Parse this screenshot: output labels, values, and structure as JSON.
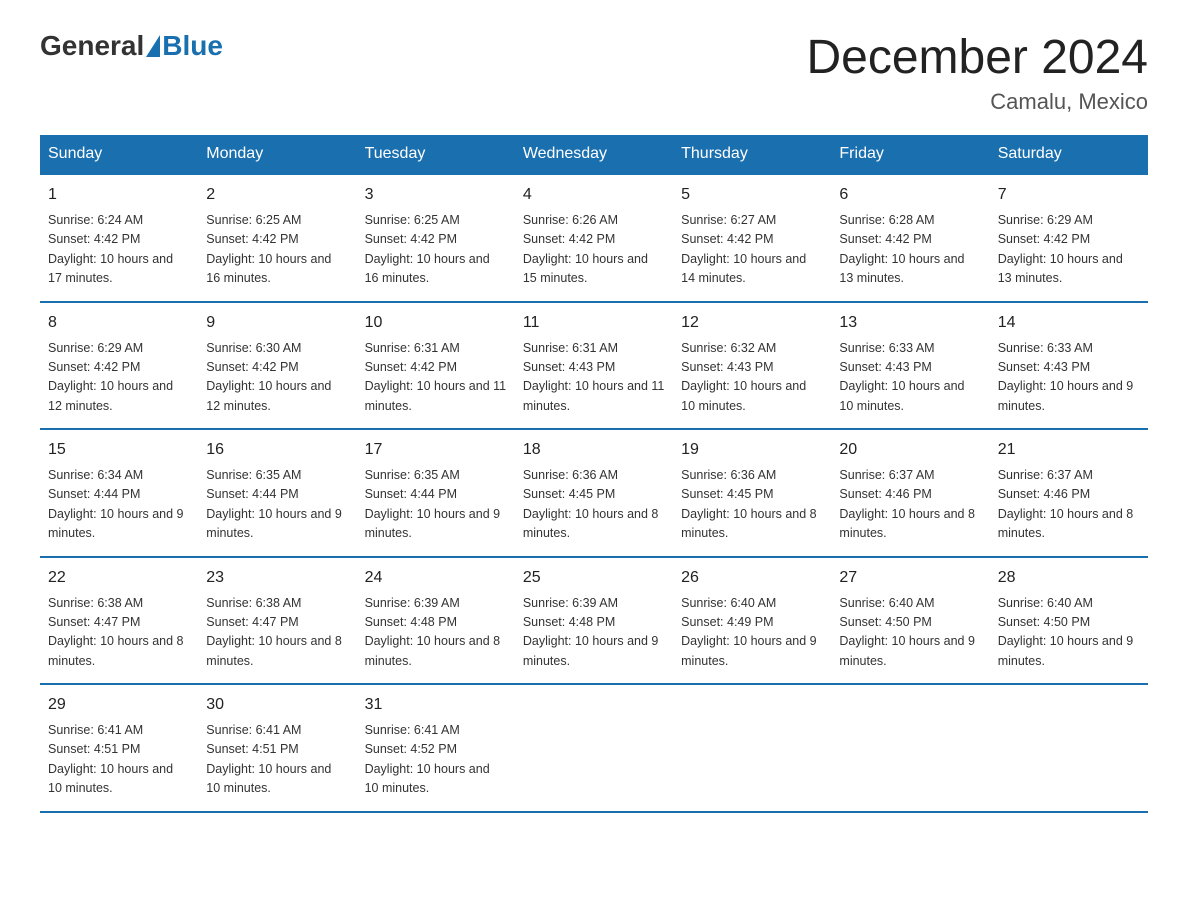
{
  "logo": {
    "general": "General",
    "blue": "Blue"
  },
  "title": {
    "month": "December 2024",
    "location": "Camalu, Mexico"
  },
  "days_of_week": [
    "Sunday",
    "Monday",
    "Tuesday",
    "Wednesday",
    "Thursday",
    "Friday",
    "Saturday"
  ],
  "weeks": [
    [
      {
        "day": "1",
        "sunrise": "6:24 AM",
        "sunset": "4:42 PM",
        "daylight": "10 hours and 17 minutes."
      },
      {
        "day": "2",
        "sunrise": "6:25 AM",
        "sunset": "4:42 PM",
        "daylight": "10 hours and 16 minutes."
      },
      {
        "day": "3",
        "sunrise": "6:25 AM",
        "sunset": "4:42 PM",
        "daylight": "10 hours and 16 minutes."
      },
      {
        "day": "4",
        "sunrise": "6:26 AM",
        "sunset": "4:42 PM",
        "daylight": "10 hours and 15 minutes."
      },
      {
        "day": "5",
        "sunrise": "6:27 AM",
        "sunset": "4:42 PM",
        "daylight": "10 hours and 14 minutes."
      },
      {
        "day": "6",
        "sunrise": "6:28 AM",
        "sunset": "4:42 PM",
        "daylight": "10 hours and 13 minutes."
      },
      {
        "day": "7",
        "sunrise": "6:29 AM",
        "sunset": "4:42 PM",
        "daylight": "10 hours and 13 minutes."
      }
    ],
    [
      {
        "day": "8",
        "sunrise": "6:29 AM",
        "sunset": "4:42 PM",
        "daylight": "10 hours and 12 minutes."
      },
      {
        "day": "9",
        "sunrise": "6:30 AM",
        "sunset": "4:42 PM",
        "daylight": "10 hours and 12 minutes."
      },
      {
        "day": "10",
        "sunrise": "6:31 AM",
        "sunset": "4:42 PM",
        "daylight": "10 hours and 11 minutes."
      },
      {
        "day": "11",
        "sunrise": "6:31 AM",
        "sunset": "4:43 PM",
        "daylight": "10 hours and 11 minutes."
      },
      {
        "day": "12",
        "sunrise": "6:32 AM",
        "sunset": "4:43 PM",
        "daylight": "10 hours and 10 minutes."
      },
      {
        "day": "13",
        "sunrise": "6:33 AM",
        "sunset": "4:43 PM",
        "daylight": "10 hours and 10 minutes."
      },
      {
        "day": "14",
        "sunrise": "6:33 AM",
        "sunset": "4:43 PM",
        "daylight": "10 hours and 9 minutes."
      }
    ],
    [
      {
        "day": "15",
        "sunrise": "6:34 AM",
        "sunset": "4:44 PM",
        "daylight": "10 hours and 9 minutes."
      },
      {
        "day": "16",
        "sunrise": "6:35 AM",
        "sunset": "4:44 PM",
        "daylight": "10 hours and 9 minutes."
      },
      {
        "day": "17",
        "sunrise": "6:35 AM",
        "sunset": "4:44 PM",
        "daylight": "10 hours and 9 minutes."
      },
      {
        "day": "18",
        "sunrise": "6:36 AM",
        "sunset": "4:45 PM",
        "daylight": "10 hours and 8 minutes."
      },
      {
        "day": "19",
        "sunrise": "6:36 AM",
        "sunset": "4:45 PM",
        "daylight": "10 hours and 8 minutes."
      },
      {
        "day": "20",
        "sunrise": "6:37 AM",
        "sunset": "4:46 PM",
        "daylight": "10 hours and 8 minutes."
      },
      {
        "day": "21",
        "sunrise": "6:37 AM",
        "sunset": "4:46 PM",
        "daylight": "10 hours and 8 minutes."
      }
    ],
    [
      {
        "day": "22",
        "sunrise": "6:38 AM",
        "sunset": "4:47 PM",
        "daylight": "10 hours and 8 minutes."
      },
      {
        "day": "23",
        "sunrise": "6:38 AM",
        "sunset": "4:47 PM",
        "daylight": "10 hours and 8 minutes."
      },
      {
        "day": "24",
        "sunrise": "6:39 AM",
        "sunset": "4:48 PM",
        "daylight": "10 hours and 8 minutes."
      },
      {
        "day": "25",
        "sunrise": "6:39 AM",
        "sunset": "4:48 PM",
        "daylight": "10 hours and 9 minutes."
      },
      {
        "day": "26",
        "sunrise": "6:40 AM",
        "sunset": "4:49 PM",
        "daylight": "10 hours and 9 minutes."
      },
      {
        "day": "27",
        "sunrise": "6:40 AM",
        "sunset": "4:50 PM",
        "daylight": "10 hours and 9 minutes."
      },
      {
        "day": "28",
        "sunrise": "6:40 AM",
        "sunset": "4:50 PM",
        "daylight": "10 hours and 9 minutes."
      }
    ],
    [
      {
        "day": "29",
        "sunrise": "6:41 AM",
        "sunset": "4:51 PM",
        "daylight": "10 hours and 10 minutes."
      },
      {
        "day": "30",
        "sunrise": "6:41 AM",
        "sunset": "4:51 PM",
        "daylight": "10 hours and 10 minutes."
      },
      {
        "day": "31",
        "sunrise": "6:41 AM",
        "sunset": "4:52 PM",
        "daylight": "10 hours and 10 minutes."
      },
      {
        "day": "",
        "sunrise": "",
        "sunset": "",
        "daylight": ""
      },
      {
        "day": "",
        "sunrise": "",
        "sunset": "",
        "daylight": ""
      },
      {
        "day": "",
        "sunrise": "",
        "sunset": "",
        "daylight": ""
      },
      {
        "day": "",
        "sunrise": "",
        "sunset": "",
        "daylight": ""
      }
    ]
  ],
  "labels": {
    "sunrise_prefix": "Sunrise: ",
    "sunset_prefix": "Sunset: ",
    "daylight_prefix": "Daylight: "
  }
}
